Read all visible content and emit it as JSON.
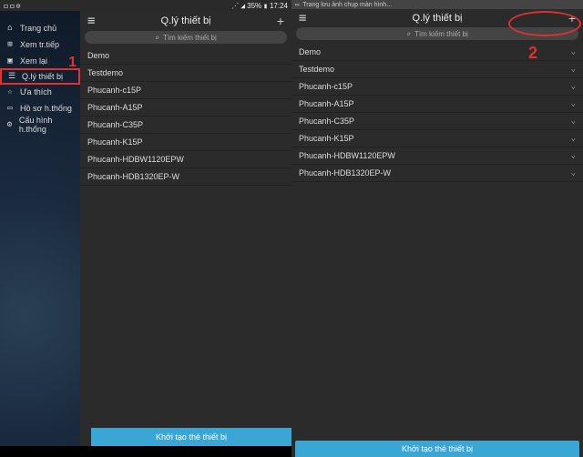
{
  "status_left": {
    "time": "17:24",
    "battery": "35%",
    "signal": "📶"
  },
  "status_right": {
    "text": "Trang lưu ảnh chụp màn hình..."
  },
  "sidebar": {
    "items": [
      {
        "label": "Trang chủ"
      },
      {
        "label": "Xem tr.tiếp"
      },
      {
        "label": "Xem lại"
      },
      {
        "label": "Q.lý thiết bị"
      },
      {
        "label": "Ưa thích"
      },
      {
        "label": "Hồ sơ h.thống"
      },
      {
        "label": "Cấu hình h.thống"
      }
    ]
  },
  "annotations": {
    "one": "1",
    "two": "2"
  },
  "header": {
    "title": "Q.lý thiết bị",
    "search_placeholder": "Tìm kiếm thiết bị"
  },
  "devices": [
    "Demo",
    "Testdemo",
    "Phucanh-c15P",
    "Phucanh-A15P",
    "Phucanh-C35P",
    "Phucanh-K15P",
    "Phucanh-HDBW1120EPW",
    "Phucanh-HDB1320EP-W"
  ],
  "bottom_button": "Khởi tạo thẻ thiết bị"
}
